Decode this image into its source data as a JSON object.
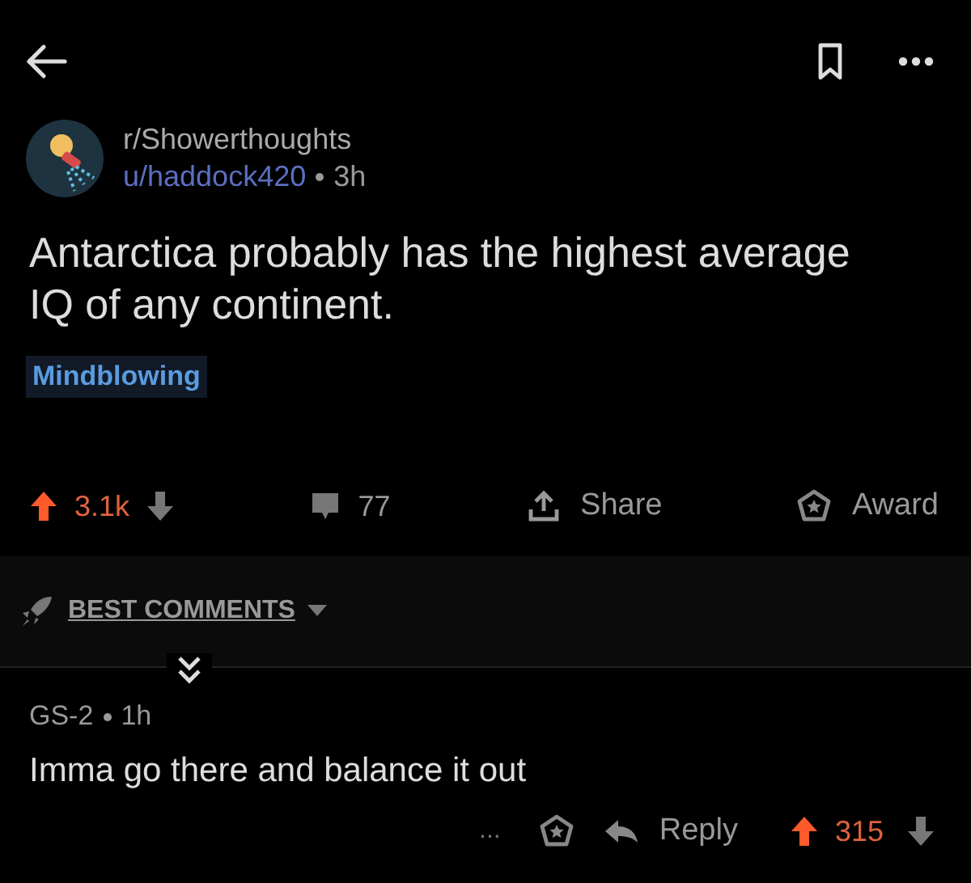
{
  "post": {
    "subreddit": "r/Showerthoughts",
    "author": "u/haddock420",
    "age": "3h",
    "title": "Antarctica probably has the highest average IQ of any continent.",
    "flair": "Mindblowing",
    "score": "3.1k",
    "upvoted": true,
    "comments": "77",
    "share": "Share",
    "award": "Award"
  },
  "sort": {
    "label": "BEST COMMENTS"
  },
  "comment": {
    "author": "GS-2",
    "age": "1h",
    "body": "Imma go there and balance it out",
    "more": "...",
    "reply": "Reply",
    "score": "315",
    "upvoted": true
  }
}
